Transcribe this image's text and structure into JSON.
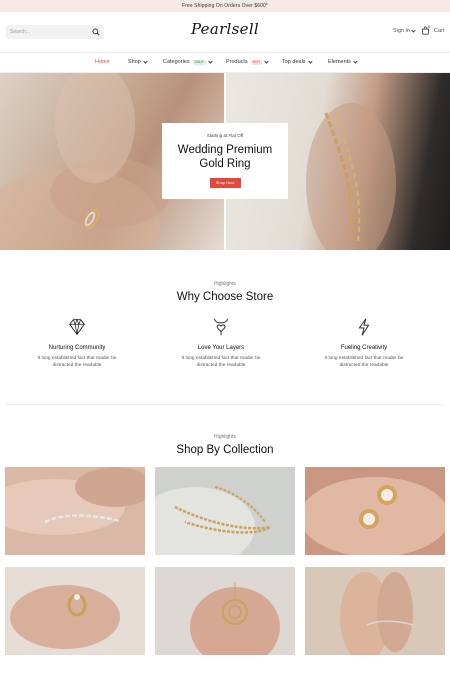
{
  "announcement": "Free Shipping On Orders Over $600*",
  "header": {
    "search_placeholder": "Search...",
    "logo": "Pearlsell",
    "signin_label": "Sign In",
    "cart_label": "Cart",
    "cart_count": "0"
  },
  "nav": {
    "home": "Home",
    "shop": "Shop",
    "categories": "Categories",
    "categories_badge": "SALE",
    "products": "Products",
    "products_badge": "HOT",
    "top_deals": "Top deals",
    "elements": "Elements"
  },
  "colors": {
    "accent": "#e2483c",
    "announcement_bg": "#f6ebe4"
  },
  "hero": {
    "kicker": "Starting at Flat Off",
    "title_line1": "Wedding Premium",
    "title_line2": "Gold Ring",
    "button": "Shop Now"
  },
  "why": {
    "kicker": "Highlights",
    "title": "Why Choose Store",
    "features": [
      {
        "icon": "diamond-icon",
        "title": "Nurturing Community",
        "desc_line1": "It long established fact that reader be",
        "desc_line2": "distracted the readable"
      },
      {
        "icon": "heart-pendant-icon",
        "title": "Love Your Layers",
        "desc_line1": "It long established fact that reader be",
        "desc_line2": "distracted the readable"
      },
      {
        "icon": "lightning-icon",
        "title": "Fueling Creativity",
        "desc_line1": "It long established fact that reader be",
        "desc_line2": "distracted the readable"
      }
    ]
  },
  "collection": {
    "kicker": "Highlights",
    "title": "Shop By Collection",
    "tiles": [
      "bracelet-photo",
      "chain-necklace-photo",
      "pearl-earrings-photo",
      "gold-ring-photo",
      "pendant-photo",
      "anklet-photo"
    ]
  }
}
